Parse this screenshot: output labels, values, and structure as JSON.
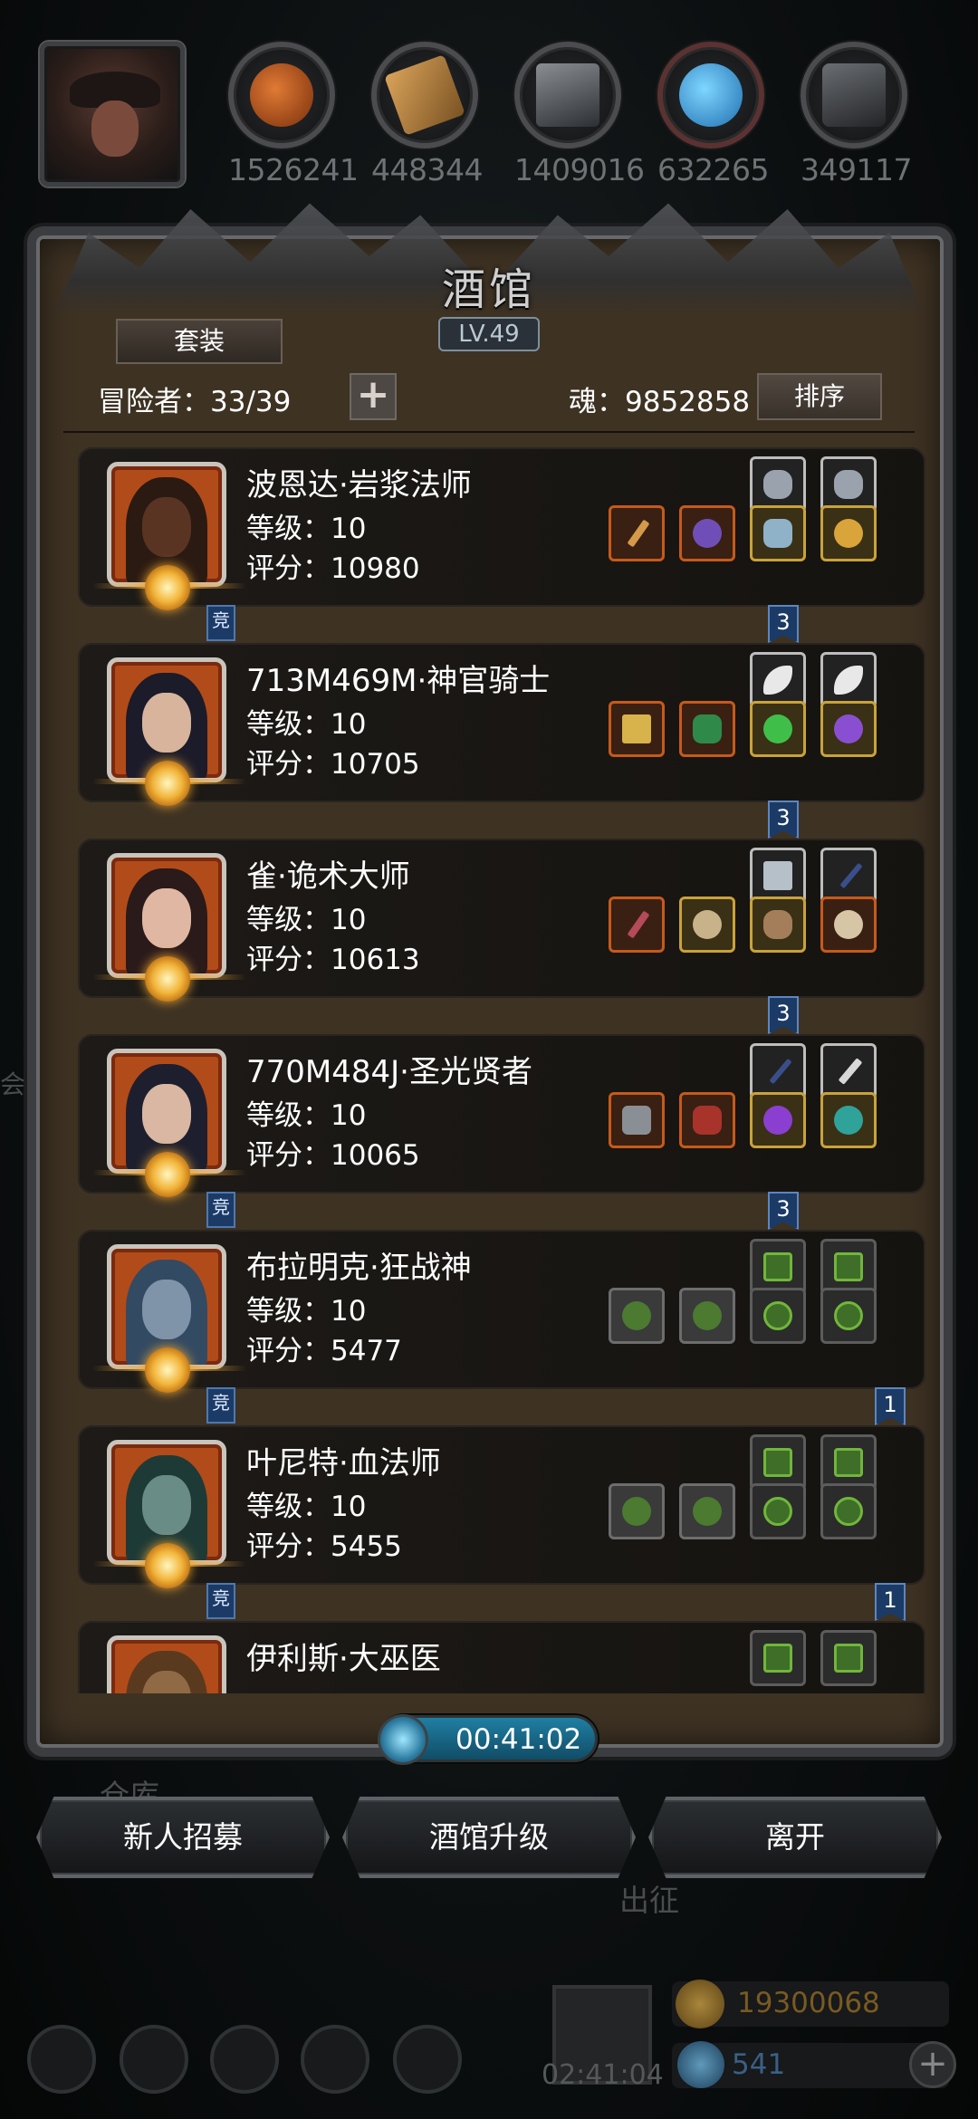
{
  "resources": [
    {
      "icon": "meat-icon",
      "value": "1526241",
      "color": "#b6551d"
    },
    {
      "icon": "wood-icon",
      "value": "448344",
      "color": "#a57a3b"
    },
    {
      "icon": "iron-icon",
      "value": "1409016",
      "color": "#555a60"
    },
    {
      "icon": "crystal-icon",
      "value": "632265",
      "color": "#2c8fd1"
    },
    {
      "icon": "stone-icon",
      "value": "349117",
      "color": "#4b4d50"
    }
  ],
  "panel": {
    "title": "酒馆",
    "level": "LV.49",
    "set_button": "套装",
    "adventurers_label": "冒险者：33/39",
    "soul_label": "魂：9852858",
    "sort_button": "排序"
  },
  "heroes": [
    {
      "name": "波恩达·岩浆法师",
      "level": "等级：10",
      "score": "评分：10980",
      "avatar_color": "#4a2a1c",
      "skin": "#5a3423",
      "jing": "竞",
      "badge": "3"
    },
    {
      "name": "713M469M·神官骑士",
      "level": "等级：10",
      "score": "评分：10705",
      "avatar_color": "#1b1b2a",
      "skin": "#d8b49c",
      "jing": "",
      "badge": "3"
    },
    {
      "name": "雀·诡术大师",
      "level": "等级：10",
      "score": "评分：10613",
      "avatar_color": "#2a1a1a",
      "skin": "#e0b7a2",
      "jing": "",
      "badge": "3"
    },
    {
      "name": "770M484J·圣光贤者",
      "level": "等级：10",
      "score": "评分：10065",
      "avatar_color": "#1d1f2e",
      "skin": "#d9b7a3",
      "jing": "竞",
      "badge": "3"
    },
    {
      "name": "布拉明克·狂战神",
      "level": "等级：10",
      "score": "评分：5477",
      "avatar_color": "#334a63",
      "skin": "#7f93a9",
      "jing": "竞",
      "badge": "1"
    },
    {
      "name": "叶尼特·血法师",
      "level": "等级：10",
      "score": "评分：5455",
      "avatar_color": "#1e3a37",
      "skin": "#6a8c86",
      "jing": "竞",
      "badge": "1"
    },
    {
      "name": "伊利斯·大巫医",
      "level": "",
      "score": "",
      "avatar_color": "#5a3a1e",
      "skin": "#8f6a44",
      "jing": "",
      "badge": ""
    }
  ],
  "timer": "00:41:02",
  "buttons": {
    "recruit": "新人招募",
    "upgrade": "酒馆升级",
    "leave": "离开"
  },
  "background": {
    "warehouse": "仓库",
    "expedition": "出征",
    "hall": "会",
    "chest_timer": "02:41:04",
    "gold": "19300068",
    "gems": "541"
  }
}
